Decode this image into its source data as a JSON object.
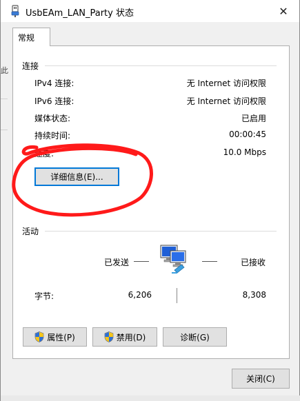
{
  "window": {
    "title": "UsbEAm_LAN_Party 状态",
    "close_glyph": "✕"
  },
  "tabs": [
    {
      "label": "常规"
    }
  ],
  "side_fragment": "此",
  "connection": {
    "section_label": "连接",
    "rows": [
      {
        "label": "IPv4 连接:",
        "value": "无 Internet 访问权限"
      },
      {
        "label": "IPv6 连接:",
        "value": "无 Internet 访问权限"
      },
      {
        "label": "媒体状态:",
        "value": "已启用"
      },
      {
        "label": "持续时间:",
        "value": "00:00:45"
      },
      {
        "label": "速度:",
        "value": "10.0 Mbps"
      }
    ],
    "details_button": "详细信息(E)..."
  },
  "activity": {
    "section_label": "活动",
    "sent_label": "已发送",
    "received_label": "已接收",
    "bytes_label": "字节:",
    "bytes_sent": "6,206",
    "bytes_received": "8,308"
  },
  "buttons": {
    "properties": "属性(P)",
    "disable": "禁用(D)",
    "diagnose": "诊断(G)",
    "close": "关闭(C)"
  },
  "icons": {
    "title": "usb-network-icon",
    "shield": "uac-shield-icon",
    "network": "network-computers-icon"
  },
  "colors": {
    "annotation_red": "#ff1a1a",
    "focus_blue": "#0078d7",
    "button_face": "#e1e1e1"
  }
}
